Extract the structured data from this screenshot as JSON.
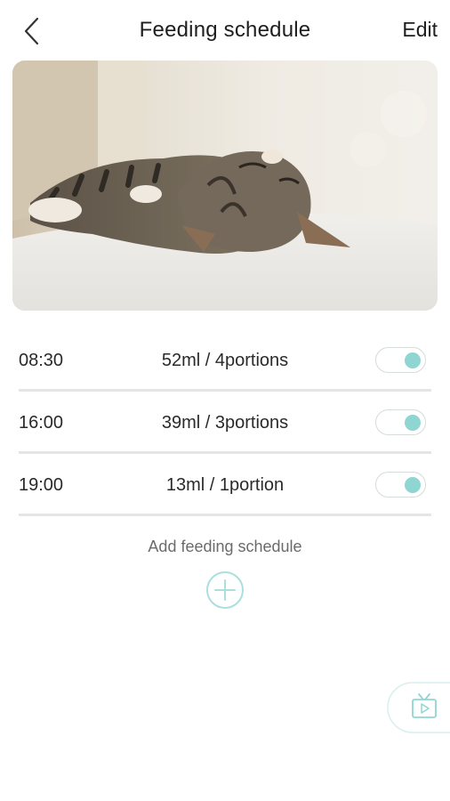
{
  "header": {
    "title": "Feeding schedule",
    "edit_label": "Edit",
    "back_icon": "chevron-left-icon"
  },
  "schedule": [
    {
      "time": "08:30",
      "amount": "52ml / 4portions",
      "enabled": true
    },
    {
      "time": "16:00",
      "amount": "39ml / 3portions",
      "enabled": true
    },
    {
      "time": "19:00",
      "amount": "13ml / 1portion",
      "enabled": true
    }
  ],
  "add": {
    "label": "Add feeding schedule",
    "icon": "plus-circle-icon"
  },
  "video_button": {
    "icon": "tv-play-icon"
  },
  "colors": {
    "accent": "#8fd6d2",
    "divider": "#e4e6e6",
    "text": "#222222",
    "muted": "#6b6b6b"
  }
}
